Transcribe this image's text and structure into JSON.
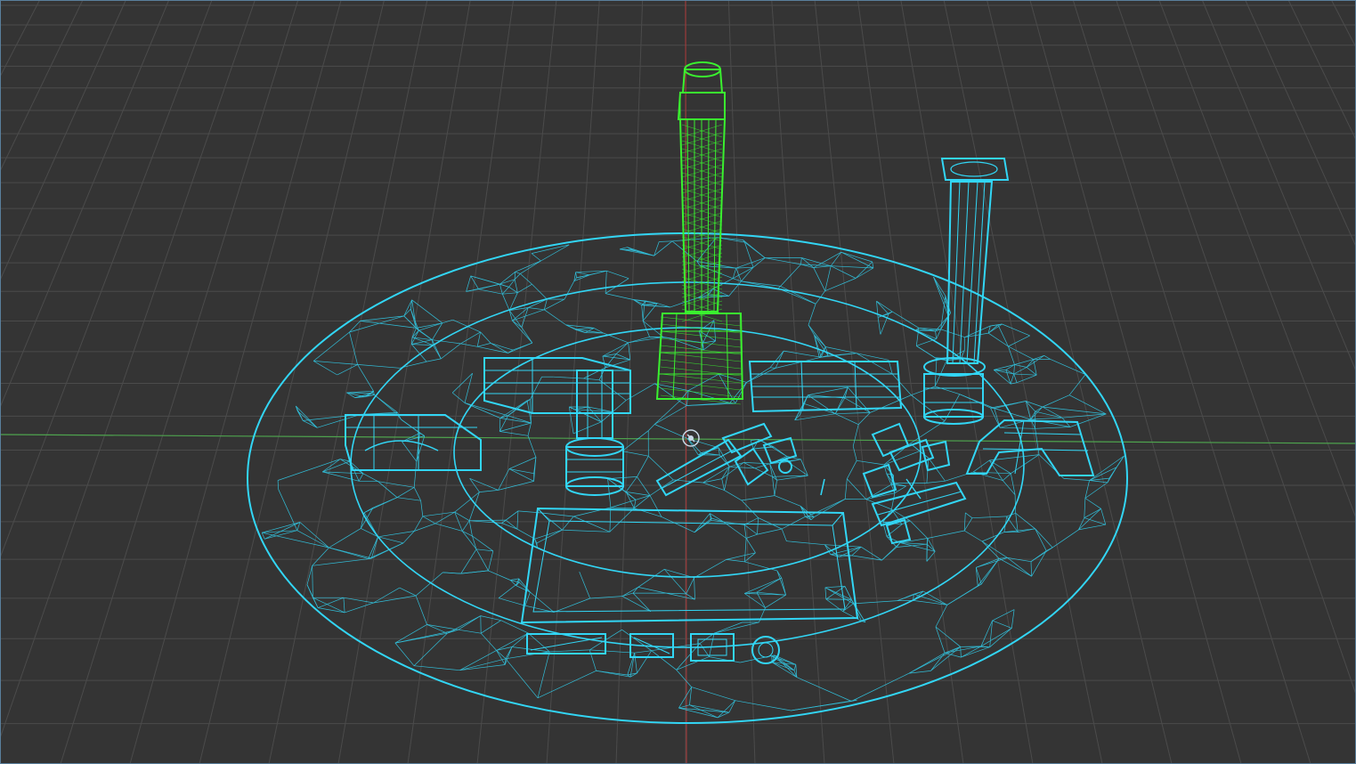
{
  "viewport": {
    "view_mode": "wireframe",
    "colors": {
      "background": "#343434",
      "grid_line": "#4b4b4b",
      "axis_x": "#4ea34e",
      "axis_y": "#9b3a3a",
      "wire_default": "#32d6f5",
      "wire_selected": "#3af12f",
      "frame": "#5a7f9c"
    },
    "objects": [
      {
        "name": "ground-disc",
        "selected": false
      },
      {
        "name": "tall-tower",
        "selected": true
      },
      {
        "name": "column",
        "selected": false
      },
      {
        "name": "beam-left",
        "selected": false
      },
      {
        "name": "beam-right",
        "selected": false
      },
      {
        "name": "arch-left",
        "selected": false
      },
      {
        "name": "arch-right",
        "selected": false
      },
      {
        "name": "post-small",
        "selected": false
      },
      {
        "name": "slab",
        "selected": false
      },
      {
        "name": "debris-cluster-center",
        "selected": false
      },
      {
        "name": "debris-cluster-right",
        "selected": false
      },
      {
        "name": "block-row",
        "selected": false
      }
    ]
  }
}
